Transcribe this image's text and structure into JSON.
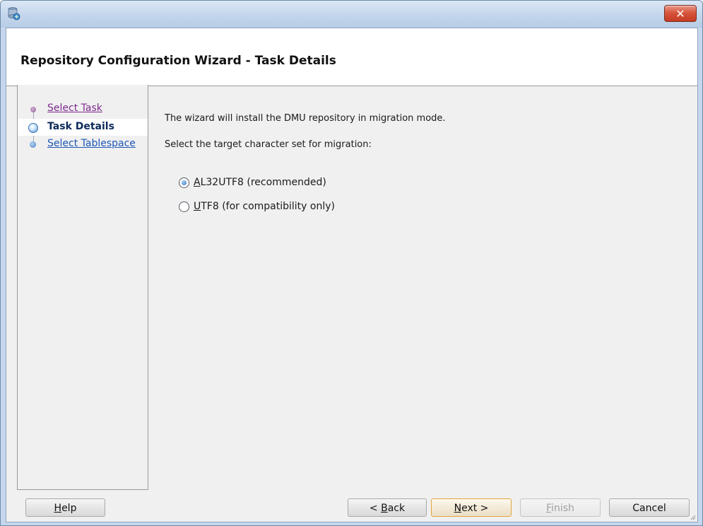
{
  "window": {
    "app_icon": "database-wizard-icon",
    "close_label": "✕"
  },
  "header": {
    "title": "Repository Configuration Wizard - Task Details"
  },
  "nav": {
    "items": [
      {
        "label": "Select Task",
        "state": "visited"
      },
      {
        "label": "Task Details",
        "state": "current"
      },
      {
        "label": "Select Tablespace",
        "state": "next"
      }
    ]
  },
  "main": {
    "intro": "The wizard will install the DMU repository in migration mode.",
    "prompt": "Select the target character set for migration:",
    "options": [
      {
        "mnemonic": "A",
        "rest": "L32UTF8 (recommended)",
        "checked": true
      },
      {
        "mnemonic": "U",
        "rest": "TF8 (for compatibility only)",
        "checked": false
      }
    ]
  },
  "buttons": {
    "help": {
      "mnemonic": "H",
      "rest": "elp"
    },
    "back": {
      "pre": "< ",
      "mnemonic": "B",
      "rest": "ack"
    },
    "next": {
      "mnemonic": "N",
      "rest": "ext >"
    },
    "finish": {
      "mnemonic": "F",
      "rest": "inish"
    },
    "cancel": "Cancel"
  },
  "colors": {
    "link": "#1d57b5",
    "visited": "#7d2a8e",
    "default_button_border": "#e3a53c"
  }
}
